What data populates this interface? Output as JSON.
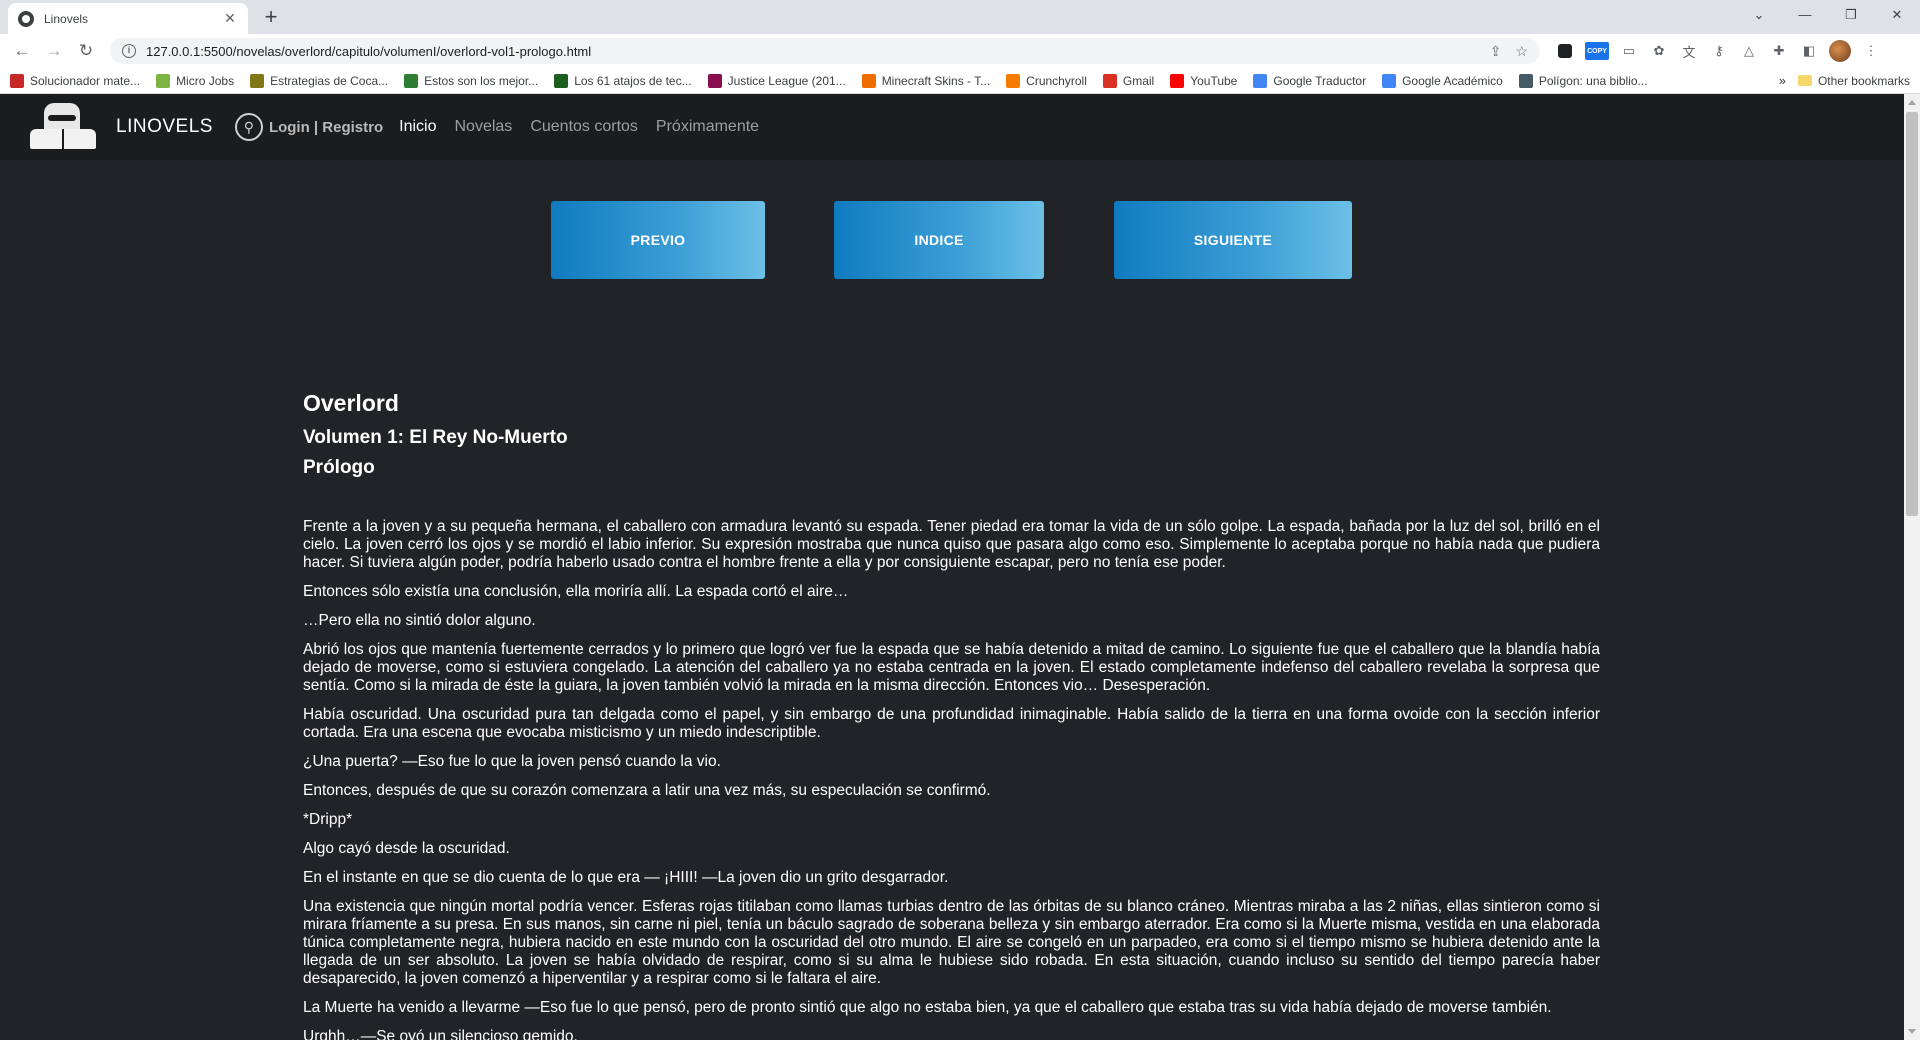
{
  "browser": {
    "tab_title": "Linovels",
    "tab_close": "✕",
    "new_tab": "+",
    "url": "127.0.0.1:5500/novelas/overlord/capitulo/volumenI/overlord-vol1-prologo.html",
    "window_controls": [
      "⌄",
      "—",
      "❐",
      "✕"
    ],
    "bookmarks": [
      {
        "label": "Solucionador mate...",
        "color": "#c62828"
      },
      {
        "label": "Micro Jobs",
        "color": "#7cb342"
      },
      {
        "label": "Estrategias de Coca...",
        "color": "#827717"
      },
      {
        "label": "Estos son los mejor...",
        "color": "#2e7d32"
      },
      {
        "label": "Los 61 atajos de tec...",
        "color": "#1b5e20"
      },
      {
        "label": "Justice League (201...",
        "color": "#880e4f"
      },
      {
        "label": "Minecraft Skins - T...",
        "color": "#ef6c00"
      },
      {
        "label": "Crunchyroll",
        "color": "#f57c00"
      },
      {
        "label": "Gmail",
        "color": "#d93025"
      },
      {
        "label": "YouTube",
        "color": "#ff0000"
      },
      {
        "label": "Google Traductor",
        "color": "#4285f4"
      },
      {
        "label": "Google Académico",
        "color": "#4285f4"
      },
      {
        "label": "Polígon: una biblio...",
        "color": "#455a64"
      }
    ],
    "bookmarks_more": "»",
    "other_bookmarks": "Other bookmarks",
    "copy_ext_label": "COPY"
  },
  "site": {
    "brand": "LINOVELS",
    "login": "Login | Registro",
    "nav": {
      "home": "Inicio",
      "novels": "Novelas",
      "short_stories": "Cuentos cortos",
      "upcoming": "Próximamente"
    },
    "accent": "#3d9fd6"
  },
  "chapter_nav": {
    "prev": "PREVIO",
    "index": "INDICE",
    "next": "SIGUIENTE"
  },
  "article": {
    "title": "Overlord",
    "volume": "Volumen 1: El Rey No-Muerto",
    "chapter": "Prólogo",
    "paragraphs": [
      "Frente a la joven y a su pequeña hermana, el caballero con armadura levantó su espada. Tener piedad era tomar la vida de un sólo golpe. La espada, bañada por la luz del sol, brilló en el cielo. La joven cerró los ojos y se mordió el labio inferior. Su expresión mostraba que nunca quiso que pasara algo como eso. Simplemente lo aceptaba porque no había nada que pudiera hacer. Si tuviera algún poder, podría haberlo usado contra el hombre frente a ella y por consiguiente escapar, pero no tenía ese poder.",
      "Entonces sólo existía una conclusión, ella moriría allí. La espada cortó el aire…",
      "…Pero ella no sintió dolor alguno.",
      "Abrió los ojos que mantenía fuertemente cerrados y lo primero que logró ver fue la espada que se había detenido a mitad de camino. Lo siguiente fue que el caballero que la blandía había dejado de moverse, como si estuviera congelado. La atención del caballero ya no estaba centrada en la joven. El estado completamente indefenso del caballero revelaba la sorpresa que sentía. Como si la mirada de éste la guiara, la joven también volvió la mirada en la misma dirección. Entonces vio… Desesperación.",
      "Había oscuridad. Una oscuridad pura tan delgada como el papel, y sin embargo de una profundidad inimaginable. Había salido de la tierra en una forma ovoide con la sección inferior cortada. Era una escena que evocaba misticismo y un miedo indescriptible.",
      "¿Una puerta? —Eso fue lo que la joven pensó cuando la vio.",
      "Entonces, después de que su corazón comenzara a latir una vez más, su especulación se confirmó.",
      "*Dripp*",
      "Algo cayó desde la oscuridad.",
      "En el instante en que se dio cuenta de lo que era — ¡HIII! —La joven dio un grito desgarrador.",
      "Una existencia que ningún mortal podría vencer. Esferas rojas titilaban como llamas turbias dentro de las órbitas de su blanco cráneo. Mientras miraba a las 2 niñas, ellas sintieron como si mirara fríamente a su presa. En sus manos, sin carne ni piel, tenía un báculo sagrado de soberana belleza y sin embargo aterrador. Era como si la Muerte misma, vestida en una elaborada túnica completamente negra, hubiera nacido en este mundo con la oscuridad del otro mundo. El aire se congeló en un parpadeo, era como si el tiempo mismo se hubiera detenido ante la llegada de un ser absoluto. La joven se había olvidado de respirar, como si su alma le hubiese sido robada. En esta situación, cuando incluso su sentido del tiempo parecía haber desaparecido, la joven comenzó a hiperventilar y a respirar como si le faltara el aire.",
      "La Muerte ha venido a llevarme —Eso fue lo que pensó, pero de pronto sintió que algo no estaba bien, ya que el caballero que estaba tras su vida había dejado de moverse también.",
      "Urghh…—Se oyó un silencioso gemido."
    ]
  }
}
